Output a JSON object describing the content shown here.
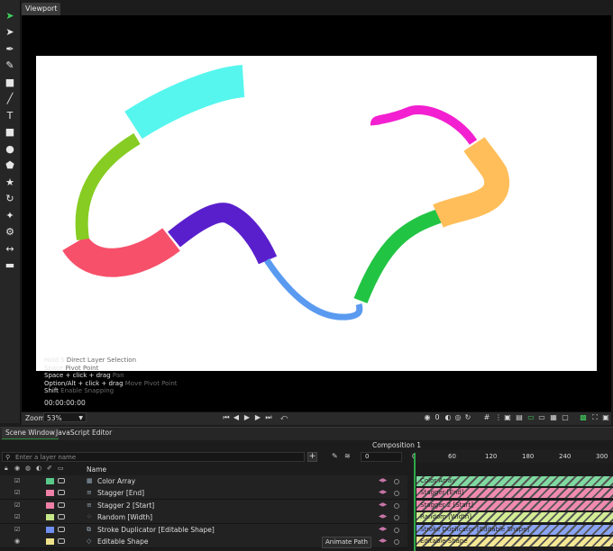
{
  "viewport": {
    "tab_label": "Viewport",
    "hints": [
      {
        "key": "Hold S",
        "action": "Direct Layer Selection"
      },
      {
        "key": "Space",
        "action": "Pivot Point"
      },
      {
        "key": "Space + click + drag",
        "action": "Pan"
      },
      {
        "key": "Option/Alt + click + drag",
        "action": "Move Pivot Point"
      },
      {
        "key": "Shift",
        "action": "Enable Snapping"
      }
    ],
    "timecode": "00:00:00:00",
    "zoom_label": "Zoom",
    "zoom_value": "53%",
    "toolbar_counter": "0"
  },
  "stroke_colors": {
    "segment_1": "#f7506a",
    "segment_2": "#86cc22",
    "segment_3": "#56f6ee",
    "segment_4": "#5a1fcc",
    "segment_5": "#5a9af0",
    "segment_6": "#22c444",
    "segment_7": "#ffbe5a",
    "segment_8": "#f220d0"
  },
  "tools": [
    "select-icon",
    "direct-select-icon",
    "pen-icon",
    "pencil-icon",
    "camera-icon",
    "line-icon",
    "text-icon",
    "rectangle-icon",
    "ellipse-icon",
    "polygon-icon",
    "star-icon",
    "rotate-icon",
    "sparkle-icon",
    "gear-icon",
    "arrows-icon",
    "pill-icon"
  ],
  "panels": {
    "tab_scene": "Scene Window",
    "tab_js": "JavaScript Editor",
    "composition_title": "Composition 1",
    "search_placeholder": "Enter a layer name",
    "frame_value": "0",
    "name_header": "Name",
    "animate_path_label": "Animate Path"
  },
  "layers": [
    {
      "name": "Color Array",
      "color": "#58c98a",
      "icon": "array-icon"
    },
    {
      "name": "Stagger [End]",
      "color": "#ee7fa6",
      "icon": "stagger-icon"
    },
    {
      "name": "Stagger 2 [Start]",
      "color": "#ee7fa6",
      "icon": "stagger-icon"
    },
    {
      "name": "Random [Width]",
      "color": "#c6e68a",
      "icon": "random-icon"
    },
    {
      "name": "Stroke Duplicator [Editable Shape]",
      "color": "#6e8ef0",
      "icon": "duplicator-icon"
    },
    {
      "name": "Editable Shape",
      "color": "#f0e28a",
      "icon": "shape-icon"
    }
  ],
  "timeline": {
    "ticks": [
      "0",
      "60",
      "120",
      "180",
      "240",
      "300"
    ],
    "bars": [
      {
        "label": "Color Array",
        "color": "#7fd9a0"
      },
      {
        "label": "Stagger [End]",
        "color": "#f08aae"
      },
      {
        "label": "Stagger 2 [Start]",
        "color": "#f08aae"
      },
      {
        "label": "Random [Width]",
        "color": "#d3ec95"
      },
      {
        "label": "Stroke Duplicator [Editable Shape]",
        "color": "#8aa4f4"
      },
      {
        "label": "Editable Shape",
        "color": "#f6e794"
      }
    ]
  }
}
